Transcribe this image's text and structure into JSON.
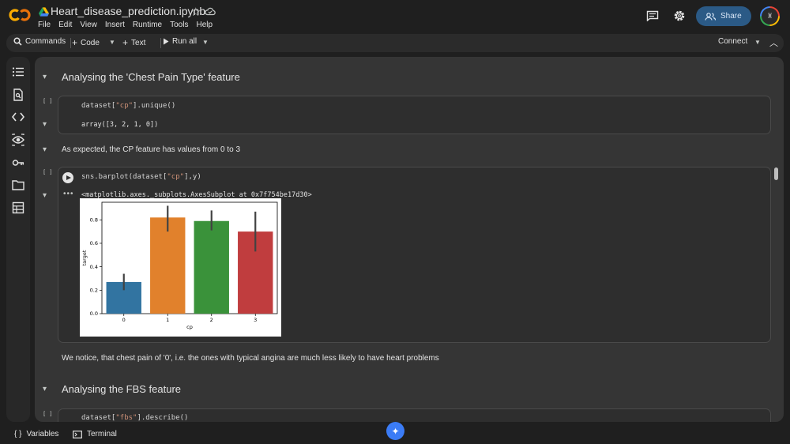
{
  "header": {
    "file_title": "Heart_disease_prediction.ipynb",
    "menu": [
      "File",
      "Edit",
      "View",
      "Insert",
      "Runtime",
      "Tools",
      "Help"
    ],
    "share_label": "Share"
  },
  "toolbar": {
    "commands_label": "Commands",
    "code_label": "Code",
    "text_label": "Text",
    "run_all_label": "Run all",
    "connect_label": "Connect"
  },
  "notebook": {
    "section1_heading": "Analysing the 'Chest Pain Type' feature",
    "cell1": {
      "prompt": "[ ]",
      "code_prefix": "dataset[",
      "code_string": "\"cp\"",
      "code_suffix": "].unique()",
      "output": "array([3, 2, 1, 0])"
    },
    "text1": "As expected, the CP feature has values from 0 to 3",
    "cell2": {
      "prompt": "[ ]",
      "code_prefix": "sns.barplot(dataset[",
      "code_string": "\"cp\"",
      "code_suffix": "],y)",
      "output": "<matplotlib.axes._subplots.AxesSubplot at 0x7f754be17d30>"
    },
    "text2": "We notice, that chest pain of '0', i.e. the ones with typical angina are much less likely to have heart problems",
    "section2_heading": "Analysing the FBS feature",
    "cell3": {
      "prompt": "[ ]",
      "code_prefix": "dataset[",
      "code_string": "\"fbs\"",
      "code_suffix": "].describe()"
    }
  },
  "chart_data": {
    "type": "bar",
    "categories": [
      "0",
      "1",
      "2",
      "3"
    ],
    "values": [
      0.27,
      0.82,
      0.79,
      0.7
    ],
    "error_low": [
      0.2,
      0.7,
      0.71,
      0.53
    ],
    "error_high": [
      0.34,
      0.92,
      0.88,
      0.87
    ],
    "colors": [
      "#3274a1",
      "#e1812c",
      "#3a923a",
      "#c03d3e"
    ],
    "xlabel": "cp",
    "ylabel": "target",
    "ylim": [
      0,
      0.95
    ],
    "yticks": [
      "0.0",
      "0.2",
      "0.4",
      "0.6",
      "0.8"
    ],
    "ytick_values": [
      0,
      0.2,
      0.4,
      0.6,
      0.8
    ],
    "grid": false
  },
  "bottombar": {
    "variables_label": "Variables",
    "terminal_label": "Terminal"
  },
  "colors": {
    "accent": "#2b5a86",
    "panel": "#353535",
    "background": "#1f1f1f"
  }
}
